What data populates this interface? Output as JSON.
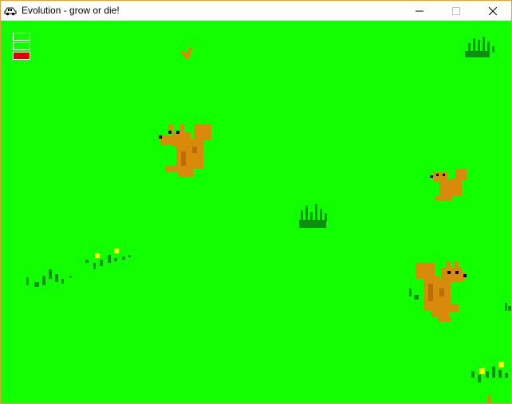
{
  "window": {
    "title": "Evolution - grow or die!",
    "icon": "car-icon",
    "controls": {
      "minimize": "minimize-icon",
      "maximize": "maximize-icon",
      "close": "close-icon"
    }
  },
  "game": {
    "background_color": "#11ff00",
    "hud": {
      "bars": [
        {
          "name": "stat-bar-1",
          "fill": 0,
          "color": "#ffffff"
        },
        {
          "name": "stat-bar-2",
          "fill": 0,
          "color": "#ffffff"
        },
        {
          "name": "stat-bar-3",
          "fill": 1,
          "color": "#e00000"
        }
      ]
    },
    "entities": {
      "squirrels": 4,
      "grass_tufts": 4,
      "flower_patches": 2
    },
    "colors": {
      "squirrel": "#d98a0a",
      "squirrel_dark": "#b86e00",
      "grass": "#0f8f12",
      "grass_dark": "#0b6e0d",
      "flower": "#ffff00"
    }
  }
}
